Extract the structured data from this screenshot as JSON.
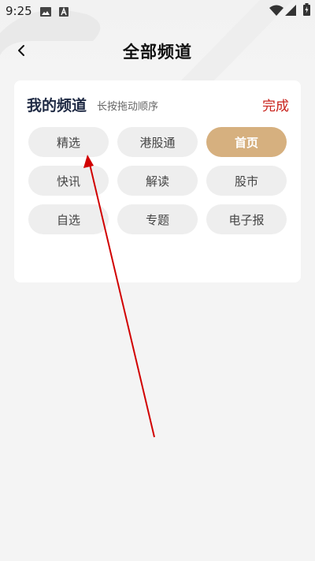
{
  "status_bar": {
    "time": "9:25"
  },
  "header": {
    "title": "全部频道"
  },
  "card": {
    "title": "我的频道",
    "hint": "长按拖动顺序",
    "done_label": "完成"
  },
  "channels": [
    {
      "label": "精选",
      "selected": false
    },
    {
      "label": "港股通",
      "selected": false
    },
    {
      "label": "首页",
      "selected": true
    },
    {
      "label": "快讯",
      "selected": false
    },
    {
      "label": "解读",
      "selected": false
    },
    {
      "label": "股市",
      "selected": false
    },
    {
      "label": "自选",
      "selected": false
    },
    {
      "label": "专题",
      "selected": false
    },
    {
      "label": "电子报",
      "selected": false
    }
  ],
  "colors": {
    "accent": "#d6b07f",
    "done_red": "#c8201a",
    "arrow": "#d10000"
  }
}
